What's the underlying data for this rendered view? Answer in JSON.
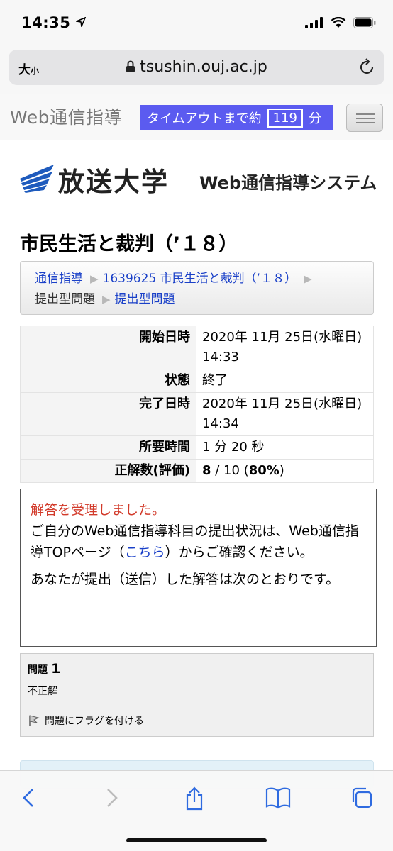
{
  "status_bar": {
    "time": "14:35"
  },
  "url_bar": {
    "text_size_label": "大",
    "text_size_small": "小",
    "domain": "tsushin.ouj.ac.jp"
  },
  "header": {
    "brand": "Web通信指導",
    "timeout_prefix": "タイムアウトまで約",
    "timeout_value": "119",
    "timeout_unit": "分"
  },
  "logo": {
    "university": "放送大学",
    "system": "Web通信指導システム"
  },
  "course_title": "市民生活と裁判（’１８）",
  "breadcrumb": {
    "item1": "通信指導",
    "item2": "1639625 市民生活と裁判（’１８）",
    "item3": "提出型問題",
    "item4": "提出型問題"
  },
  "summary": {
    "start_label": "開始日時",
    "start_value": "2020年 11月 25日(水曜日) 14:33",
    "state_label": "状態",
    "state_value": "終了",
    "finish_label": "完了日時",
    "finish_value": "2020年 11月 25日(水曜日) 14:34",
    "duration_label": "所要時間",
    "duration_value": "1 分 20 秒",
    "score_label": "正解数(評価)",
    "score_correct": "8",
    "score_total": " / 10 (",
    "score_percent": "80%",
    "score_close": ")"
  },
  "feedback": {
    "received": "解答を受理しました。",
    "line2_prefix": " ご自分のWeb通信指導科目の提出状況は、Web通信指導TOPページ（",
    "link": "こちら",
    "line2_suffix": "）からご確認ください。",
    "line3": "あなたが提出（送信）した解答は次のとおりです。"
  },
  "question": {
    "label": "問題",
    "number": "1",
    "state": "不正解",
    "flag": "問題にフラグを付ける"
  },
  "colors": {
    "timeout_bg": "#5b5bf0",
    "link": "#1a40c8",
    "alert_red": "#d23a2a",
    "logo_blue": "#1f5bbd"
  }
}
